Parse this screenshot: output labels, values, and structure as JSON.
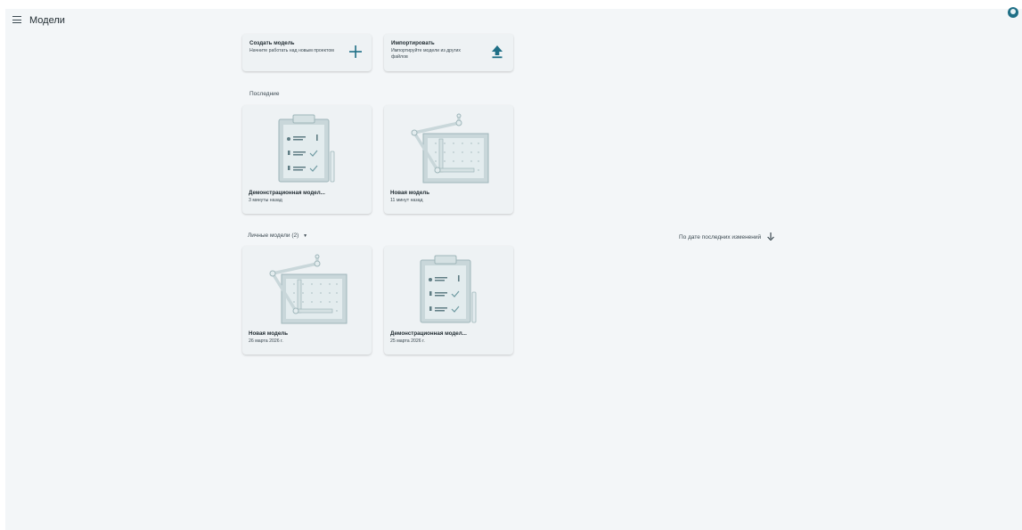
{
  "header": {
    "title": "Модели",
    "menu_icon": "menu-icon",
    "avatar_icon": "account-icon"
  },
  "actions": [
    {
      "title": "Создать модель",
      "subtitle": "Начните работать над новым проектом",
      "icon": "plus-icon"
    },
    {
      "title": "Импортировать",
      "subtitle": "Импортируйте модели из других файлов",
      "icon": "upload-icon"
    }
  ],
  "recent": {
    "label": "Последние",
    "cards": [
      {
        "name": "Демонстрационная модел...",
        "date": "3 минуты назад",
        "thumb": "clipboard-checklist-illustration"
      },
      {
        "name": "Новая модель",
        "date": "11 минут назад",
        "thumb": "drafting-board-illustration"
      }
    ]
  },
  "personal": {
    "label": "Личные модели (2)",
    "sort_label": "По дате последних изменений",
    "cards": [
      {
        "name": "Новая модель",
        "date": "26 марта 2026 г.",
        "thumb": "drafting-board-illustration"
      },
      {
        "name": "Демонстрационная модел...",
        "date": "25 марта 2026 г.",
        "thumb": "clipboard-checklist-illustration"
      }
    ]
  },
  "colors": {
    "accent": "#1f6f86",
    "background": "#f3f6f8",
    "card": "#eef2f4"
  }
}
